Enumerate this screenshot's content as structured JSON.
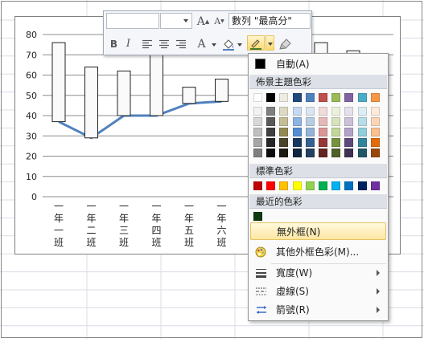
{
  "chart": {
    "y_ticks": [
      "80",
      "70",
      "60",
      "50",
      "40",
      "30",
      "20",
      "10",
      "0"
    ],
    "categories": [
      {
        "line1": "一",
        "line2": "年",
        "line3": "一",
        "line4": "班"
      },
      {
        "line1": "一",
        "line2": "年",
        "line3": "二",
        "line4": "班"
      },
      {
        "line1": "一",
        "line2": "年",
        "line3": "三",
        "line4": "班"
      },
      {
        "line1": "一",
        "line2": "年",
        "line3": "四",
        "line4": "班"
      },
      {
        "line1": "一",
        "line2": "年",
        "line3": "五",
        "line4": "班"
      },
      {
        "line1": "一",
        "line2": "年",
        "line3": "六",
        "line4": "班"
      }
    ]
  },
  "chart_data": {
    "type": "bar",
    "categories": [
      "一年一班",
      "一年二班",
      "一年三班",
      "一年四班",
      "一年五班",
      "一年六班"
    ],
    "series": [
      {
        "name": "最高分",
        "values": [
          76,
          64,
          62,
          72,
          54,
          58
        ]
      },
      {
        "values": [
          37,
          29,
          40,
          40,
          46,
          47
        ]
      }
    ],
    "visible_partial_bars": [
      {
        "high": 76
      },
      {
        "high": 72
      }
    ],
    "ylim": [
      0,
      80
    ],
    "grid": true,
    "line_color": "#4f81bd"
  },
  "toolbar": {
    "font_grow": "A",
    "font_shrink": "A",
    "series_select": "數列 \"最高分\"",
    "bold": "B",
    "italic": "I",
    "font_color": "A"
  },
  "menu": {
    "automatic": "自動(A)",
    "theme_colors_header": "佈景主題色彩",
    "standard_colors_header": "標準色彩",
    "recent_colors_header": "最近的色彩",
    "no_outline": "無外框(N)",
    "more_colors": "其他外框色彩(M)...",
    "weight": "寬度(W)",
    "dashes": "虛線(S)",
    "arrows": "箭號(R)"
  },
  "colors": {
    "theme_base": [
      "#ffffff",
      "#000000",
      "#eeece1",
      "#1f497d",
      "#4f81bd",
      "#c0504d",
      "#9bbb59",
      "#8064a2",
      "#4bacc6",
      "#f79646"
    ],
    "theme_shades": [
      [
        "#f2f2f2",
        "#7f7f7f",
        "#ddd9c3",
        "#c6d9f0",
        "#dbe5f1",
        "#f2dcdb",
        "#ebf1dd",
        "#e5e0ec",
        "#dbeef3",
        "#fdeada"
      ],
      [
        "#d8d8d8",
        "#595959",
        "#c4bd97",
        "#8db3e2",
        "#b8cce4",
        "#e5b9b7",
        "#d7e3bc",
        "#ccc1d9",
        "#b7dde8",
        "#fbd5b5"
      ],
      [
        "#bfbfbf",
        "#3f3f3f",
        "#938953",
        "#548dd4",
        "#95b3d7",
        "#d99694",
        "#c3d69b",
        "#b2a2c7",
        "#92cddc",
        "#fac08f"
      ],
      [
        "#a5a5a5",
        "#262626",
        "#494429",
        "#17365d",
        "#366092",
        "#953734",
        "#76923c",
        "#5f497a",
        "#31859b",
        "#e36c09"
      ],
      [
        "#7f7f7f",
        "#0c0c0c",
        "#1d1b10",
        "#0f243e",
        "#244061",
        "#632423",
        "#4f6128",
        "#3f3151",
        "#205867",
        "#974806"
      ]
    ],
    "standard": [
      "#c00000",
      "#ff0000",
      "#ffc000",
      "#ffff00",
      "#92d050",
      "#00b050",
      "#00b0f0",
      "#0070c0",
      "#002060",
      "#7030a0"
    ],
    "recent": [
      "#0f3a0f"
    ],
    "automatic": "#000000",
    "hover_border": "#e5c365"
  }
}
